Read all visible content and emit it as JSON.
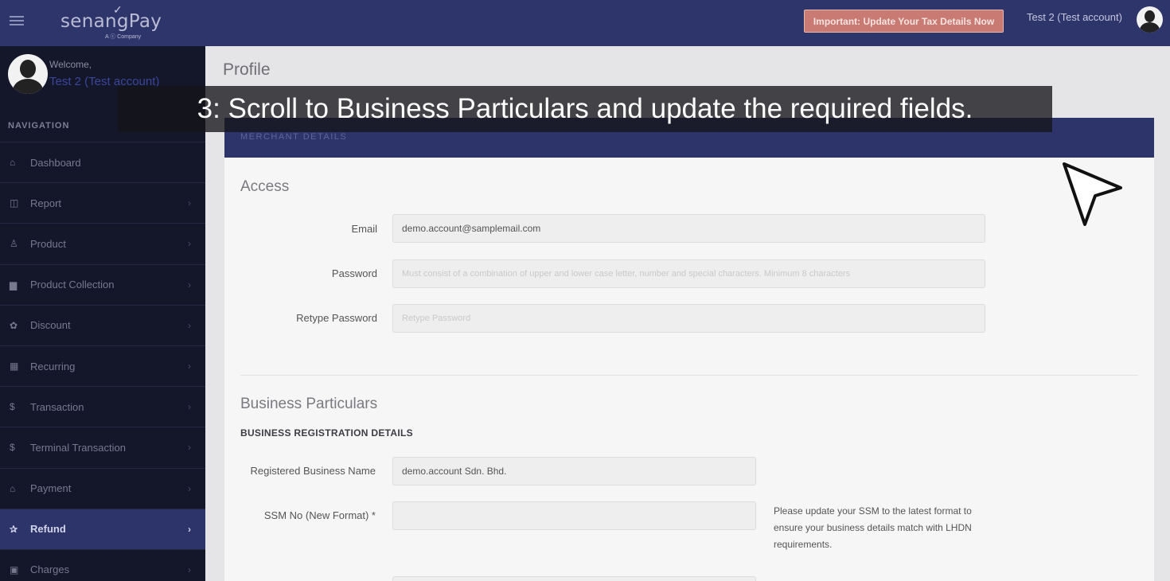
{
  "topbar": {
    "menu_icon": "hamburger-icon",
    "logo_text": "senangPay",
    "logo_sub": "A ⓒ Company",
    "tax_button": "Important: Update Your Tax Details Now",
    "user_name": "Test 2 (Test account)",
    "avatar_icon": "user-avatar-icon"
  },
  "sidebar": {
    "welcome_label": "Welcome,",
    "welcome_name": "Test 2 (Test account)",
    "nav_heading": "NAVIGATION",
    "items": [
      {
        "label": "Dashboard",
        "icon": "home-icon",
        "glyph": "⌂",
        "has_chevron": false
      },
      {
        "label": "Report",
        "icon": "report-icon",
        "glyph": "◫",
        "has_chevron": true
      },
      {
        "label": "Product",
        "icon": "flask-icon",
        "glyph": "♙",
        "has_chevron": true
      },
      {
        "label": "Product Collection",
        "icon": "collection-icon",
        "glyph": "▆",
        "has_chevron": true
      },
      {
        "label": "Discount",
        "icon": "gift-icon",
        "glyph": "✿",
        "has_chevron": true
      },
      {
        "label": "Recurring",
        "icon": "calendar-icon",
        "glyph": "▦",
        "has_chevron": true
      },
      {
        "label": "Transaction",
        "icon": "dollar-icon",
        "glyph": "$",
        "has_chevron": true
      },
      {
        "label": "Terminal Transaction",
        "icon": "dollar-icon",
        "glyph": "$",
        "has_chevron": true
      },
      {
        "label": "Payment",
        "icon": "bank-icon",
        "glyph": "⌂",
        "has_chevron": true
      },
      {
        "label": "Refund",
        "icon": "refund-icon",
        "glyph": "✰",
        "has_chevron": true,
        "active": true
      },
      {
        "label": "Charges",
        "icon": "money-icon",
        "glyph": "▣",
        "has_chevron": true
      }
    ]
  },
  "main": {
    "page_title": "Profile",
    "panel_header": "MERCHANT DETAILS",
    "access": {
      "title": "Access",
      "email_label": "Email",
      "email_value": "demo.account@samplemail.com",
      "password_label": "Password",
      "password_placeholder": "Must consist of a combination of upper and lower case letter, number and special characters. Minimum 8 characters",
      "retype_label": "Retype Password",
      "retype_placeholder": "Retype Password"
    },
    "business": {
      "title": "Business Particulars",
      "sub_heading": "BUSINESS REGISTRATION DETAILS",
      "name_label": "Registered Business Name",
      "name_value": "demo.account Sdn. Bhd.",
      "ssm_label": "SSM No (New Format) *",
      "ssm_value": "",
      "ssm_note": "Please update your SSM to the latest format to ensure your business details match with LHDN requirements."
    }
  },
  "overlay": {
    "caption": "3: Scroll to Business Particulars and update the required fields."
  },
  "colors": {
    "topbar": "#2e356b",
    "sidebar": "#14162a",
    "active_nav": "#2d3469",
    "tax_button": "#c87a73"
  }
}
